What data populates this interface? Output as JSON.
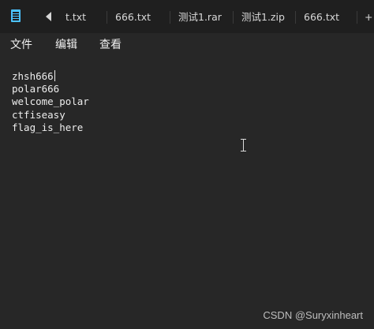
{
  "tabbar": {
    "app_icon": "notepad-icon",
    "scroll_icon": "triangle-left-icon",
    "tabs": [
      {
        "label": "t.txt"
      },
      {
        "label": "666.txt"
      },
      {
        "label": "测试1.rar"
      },
      {
        "label": "测试1.zip"
      },
      {
        "label": "666.txt"
      },
      {
        "label": "+"
      }
    ]
  },
  "menu": {
    "items": [
      {
        "label": "文件"
      },
      {
        "label": "编辑"
      },
      {
        "label": "查看"
      }
    ]
  },
  "editor": {
    "lines": [
      "zhsh666",
      "polar666",
      "welcome_polar",
      "ctfiseasy",
      "flag_is_here"
    ],
    "pointer_icon": "text-cursor-icon"
  },
  "watermark": {
    "text": "CSDN @Suryxinheart"
  },
  "colors": {
    "background": "#272727",
    "tabbar": "#1f1f1f",
    "text": "#ededed",
    "icon_accent": "#4cc2ff"
  }
}
